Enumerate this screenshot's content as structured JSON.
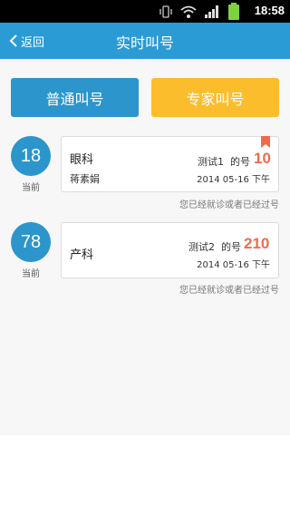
{
  "status_bar": {
    "time": "18:58"
  },
  "nav": {
    "back_label": "返回",
    "title": "实时叫号"
  },
  "buttons": {
    "normal_label": "普通叫号",
    "expert_label": "专家叫号"
  },
  "queues": [
    {
      "current_number": "18",
      "current_label": "当前",
      "department": "眼科",
      "doctor": "蒋素娟",
      "tester": "测试1",
      "number_prefix": "的号",
      "number": "10",
      "date": "2014 05-16 下午",
      "note": "您已经就诊或者已经过号",
      "bookmarked": true
    },
    {
      "current_number": "78",
      "current_label": "当前",
      "department": "产科",
      "doctor": "",
      "tester": "测试2",
      "number_prefix": "的号",
      "number": "210",
      "date": "2014 05-16 下午",
      "note": "您已经就诊或者已经过号",
      "bookmarked": false
    }
  ],
  "colors": {
    "nav": "#2b9bd6",
    "primary": "#2b95cc",
    "expert": "#fcbd2c",
    "number": "#ef6b4e"
  }
}
